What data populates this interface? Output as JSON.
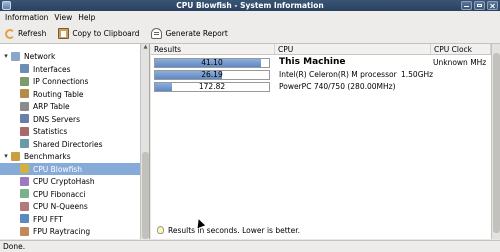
{
  "window": {
    "title": "CPU Blowfish - System Information"
  },
  "menu": [
    "Information",
    "View",
    "Help"
  ],
  "toolbar": {
    "refresh": "Refresh",
    "copy": "Copy to Clipboard",
    "report": "Generate Report"
  },
  "sidebar": {
    "items": [
      {
        "label": "Network",
        "icon": "network-icon",
        "level": 0,
        "expanded": true
      },
      {
        "label": "Interfaces",
        "icon": "interfaces-icon",
        "level": 1
      },
      {
        "label": "IP Connections",
        "icon": "ip-connections-icon",
        "level": 1
      },
      {
        "label": "Routing Table",
        "icon": "routing-table-icon",
        "level": 1
      },
      {
        "label": "ARP Table",
        "icon": "arp-table-icon",
        "level": 1
      },
      {
        "label": "DNS Servers",
        "icon": "dns-servers-icon",
        "level": 1
      },
      {
        "label": "Statistics",
        "icon": "statistics-icon",
        "level": 1
      },
      {
        "label": "Shared Directories",
        "icon": "shared-directories-icon",
        "level": 1
      },
      {
        "label": "Benchmarks",
        "icon": "benchmarks-icon",
        "level": 0,
        "expanded": true
      },
      {
        "label": "CPU Blowfish",
        "icon": "cpu-blowfish-icon",
        "level": 1,
        "selected": true
      },
      {
        "label": "CPU CryptoHash",
        "icon": "cpu-cryptohash-icon",
        "level": 1
      },
      {
        "label": "CPU Fibonacci",
        "icon": "cpu-fibonacci-icon",
        "level": 1
      },
      {
        "label": "CPU N-Queens",
        "icon": "cpu-nqueens-icon",
        "level": 1
      },
      {
        "label": "FPU FFT",
        "icon": "fpu-fft-icon",
        "level": 1
      },
      {
        "label": "FPU Raytracing",
        "icon": "fpu-raytracing-icon",
        "level": 1
      }
    ]
  },
  "table": {
    "columns": [
      "Results",
      "CPU",
      "CPU Clock"
    ],
    "rows": [
      {
        "value": "41.10",
        "fill": 0.93,
        "cpu": "This Machine",
        "clock": "Unknown MHz",
        "bold": true
      },
      {
        "value": "26.19",
        "fill": 0.59,
        "cpu": "Intel(R) Celeron(R) M processor",
        "clock": "1.50GHz",
        "bold": false
      },
      {
        "value": "172.82",
        "fill": 0.15,
        "cpu": "PowerPC 740/750 (280.00MHz)",
        "clock": "",
        "bold": false
      }
    ]
  },
  "note": "Results in seconds. Lower is better.",
  "status": "Done."
}
